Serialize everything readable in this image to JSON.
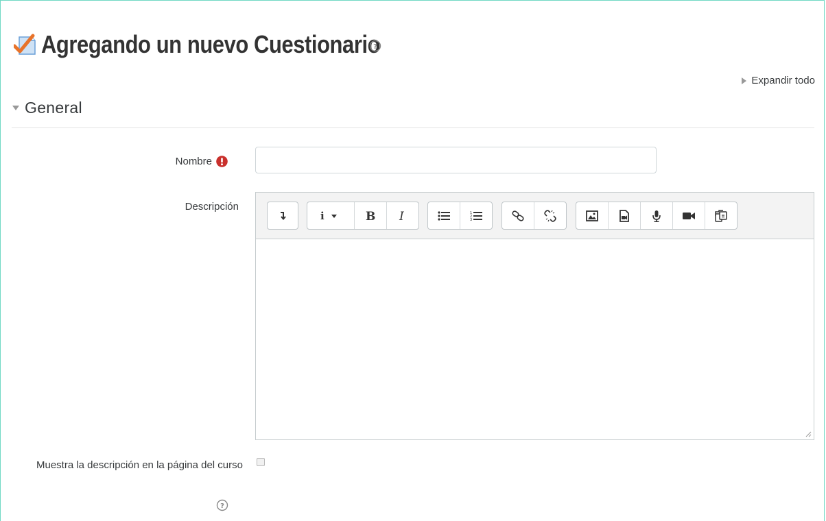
{
  "header": {
    "title": "Agregando un nuevo Cuestionario",
    "icon": "quiz-icon",
    "help_icon": "help-icon"
  },
  "expand_all": {
    "label": "Expandir todo"
  },
  "section": {
    "label": "General"
  },
  "form": {
    "name": {
      "label": "Nombre",
      "value": "",
      "required_icon": "required-icon"
    },
    "description": {
      "label": "Descripción",
      "toolbar": [
        [
          "collapse-icon"
        ],
        [
          "info-dropdown-icon",
          "bold-icon",
          "italic-icon"
        ],
        [
          "unordered-list-icon",
          "ordered-list-icon"
        ],
        [
          "link-icon",
          "unlink-icon"
        ],
        [
          "image-icon",
          "media-icon",
          "record-audio-icon",
          "record-video-icon",
          "manage-files-icon"
        ]
      ]
    },
    "show_description": {
      "label": "Muestra la descripción en la página del curso",
      "checked": false
    }
  },
  "colors": {
    "frame": "#6fd8c3",
    "required": "#c9302c",
    "quiz_check": "#e8732a",
    "quiz_paper": "#6aa0d8"
  }
}
